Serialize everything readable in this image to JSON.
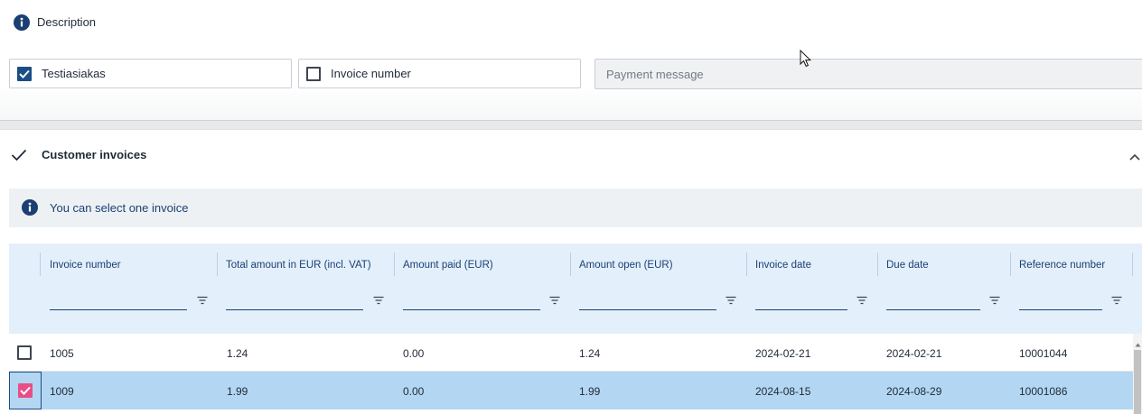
{
  "description": {
    "title": "Description"
  },
  "filters": {
    "customer": {
      "label": "Testiasiakas",
      "checked": true
    },
    "invoice_number": {
      "label": "Invoice number",
      "checked": false
    },
    "payment_message": {
      "placeholder": "Payment message"
    }
  },
  "customer_invoices": {
    "title": "Customer invoices",
    "notice": "You can select one invoice",
    "columns": [
      "Invoice number",
      "Total amount in EUR (incl. VAT)",
      "Amount paid (EUR)",
      "Amount open (EUR)",
      "Invoice date",
      "Due date",
      "Reference number"
    ],
    "rows": [
      {
        "selected": false,
        "cells": [
          "1005",
          "1.24",
          "0.00",
          "1.24",
          "2024-02-21",
          "2024-02-21",
          "10001044"
        ]
      },
      {
        "selected": true,
        "cells": [
          "1009",
          "1.99",
          "0.00",
          "1.99",
          "2024-08-15",
          "2024-08-29",
          "10001086"
        ]
      }
    ]
  },
  "colors": {
    "accent": "#1b4d87",
    "selected_row": "#b3d6f2",
    "header_bg": "#e3f0fb",
    "selected_checkbox": "#e84f86"
  },
  "icons": [
    "info-icon",
    "check-icon",
    "chevron-up-icon",
    "filter-icon",
    "mouse-cursor-icon"
  ]
}
